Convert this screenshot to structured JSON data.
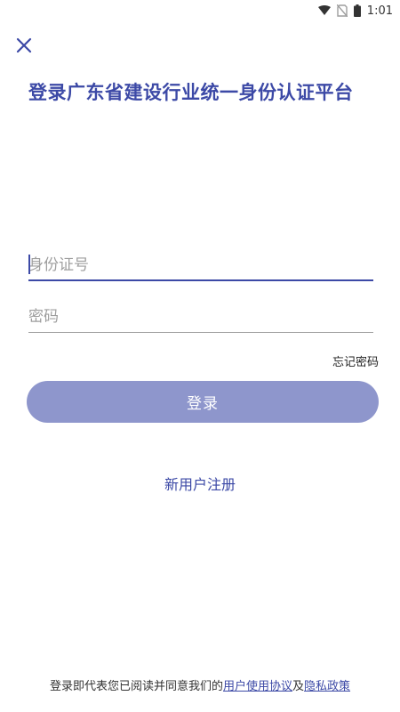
{
  "status_bar": {
    "time": "1:01",
    "icons": [
      "wifi-icon",
      "no-sim-icon",
      "battery-icon"
    ]
  },
  "header": {
    "close_icon": "close-icon",
    "title": "登录广东省建设行业统一身份认证平台"
  },
  "form": {
    "id_placeholder": "身份证号",
    "id_value": "",
    "password_placeholder": "密码",
    "password_value": "",
    "forgot_password_label": "忘记密码",
    "login_label": "登录",
    "register_label": "新用户注册"
  },
  "footer": {
    "agreement_prefix": "登录即代表您已阅读并同意我们的",
    "user_agreement_label": "用户使用协议",
    "and_text": "及",
    "privacy_policy_label": "隐私政策"
  },
  "colors": {
    "accent": "#3c49a6",
    "button_disabled": "#8e96cc"
  }
}
